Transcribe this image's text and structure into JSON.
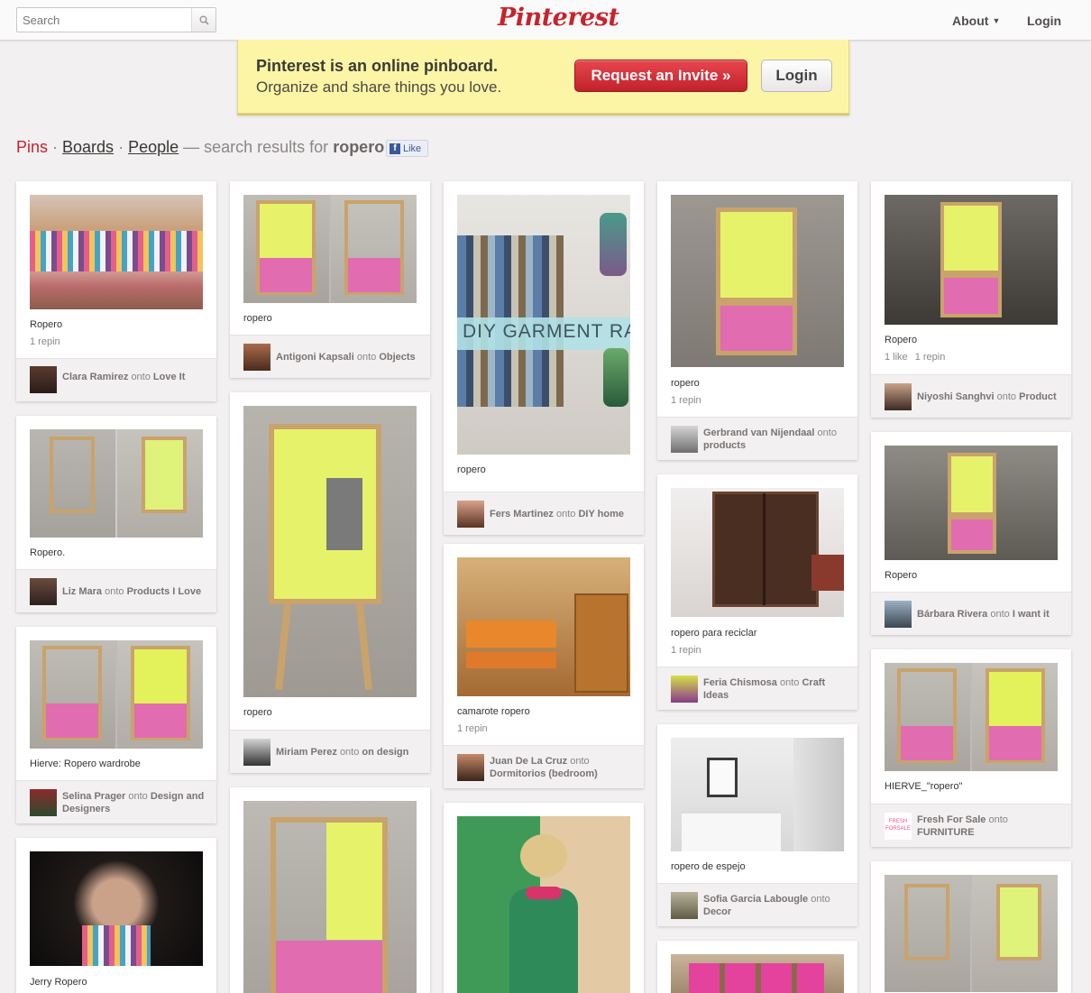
{
  "header": {
    "search_placeholder": "Search",
    "logo": "Pinterest",
    "about": "About",
    "login": "Login"
  },
  "banner": {
    "title": "Pinterest is an online pinboard.",
    "subtitle": "Organize and share things you love.",
    "invite_button": "Request an Invite »",
    "login_button": "Login"
  },
  "filters": {
    "pins": "Pins",
    "sep": " · ",
    "boards": "Boards",
    "people": "People",
    "results_prefix": " — search results for ",
    "query": "ropero",
    "like": "Like"
  },
  "pins": [
    {
      "desc": "Ropero",
      "stats": [
        "1 repin"
      ],
      "user": "Clara Ramirez",
      "onto": "onto",
      "board": "Love It"
    },
    {
      "desc": "Ropero.",
      "stats": [],
      "user": "Liz Mara",
      "onto": "onto",
      "board": "Products I Love"
    },
    {
      "desc": "Hierve: Ropero wardrobe",
      "stats": [],
      "user": "Selina Prager",
      "onto": "onto",
      "board": "Design and Designers"
    },
    {
      "desc": "Jerry Ropero",
      "stats": []
    },
    {
      "desc": "ropero",
      "stats": [],
      "user": "Antigoni Kapsali",
      "onto": "onto",
      "board": "Objects"
    },
    {
      "desc": "ropero",
      "stats": [],
      "user": "Miriam Perez",
      "onto": "onto",
      "board": "on design"
    },
    {
      "desc": "",
      "stats": []
    },
    {
      "desc": "ropero",
      "stats": [],
      "user": "Fers Martinez",
      "onto": "onto",
      "board": "DIY home",
      "overlay": "DIY GARMENT RACK"
    },
    {
      "desc": "camarote ropero",
      "stats": [
        "1 repin"
      ],
      "user": "Juan De La Cruz",
      "onto": "onto",
      "board": "Dormitorios (bedroom)"
    },
    {
      "desc": "",
      "stats": []
    },
    {
      "desc": "ropero",
      "stats": [
        "1 repin"
      ],
      "user": "Gerbrand van Nijendaal",
      "onto": "onto",
      "board": "products"
    },
    {
      "desc": "ropero para reciclar",
      "stats": [
        "1 repin"
      ],
      "user": "Feria Chismosa",
      "onto": "onto",
      "board": "Craft Ideas"
    },
    {
      "desc": "ropero de espejo",
      "stats": [],
      "user": "Sofia Garcia Labougle",
      "onto": "onto",
      "board": "Decor"
    },
    {
      "desc": "",
      "stats": []
    },
    {
      "desc": "Ropero",
      "stats": [
        "1 like",
        "1 repin"
      ],
      "user": "Niyoshi Sanghvi",
      "onto": "onto",
      "board": "Product"
    },
    {
      "desc": "Ropero",
      "stats": [],
      "user": "Bárbara Rivera",
      "onto": "onto",
      "board": "I want it"
    },
    {
      "desc": "HIERVE_\"ropero\"",
      "stats": [],
      "user": "Fresh For Sale",
      "onto": "onto",
      "board": "FURNITURE",
      "avatar_text": "FRESH FORSALE"
    },
    {
      "desc": "",
      "stats": []
    }
  ]
}
